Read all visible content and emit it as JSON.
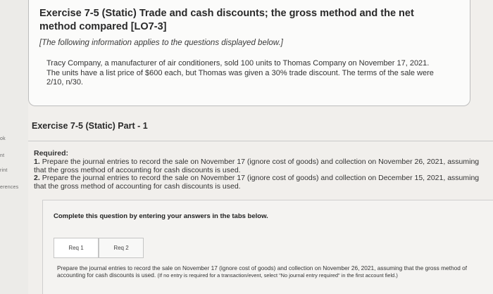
{
  "sidebar": {
    "items": [
      "ok",
      "nt",
      "rint",
      "erences"
    ]
  },
  "exercise": {
    "title": "Exercise 7-5 (Static) Trade and cash discounts; the gross method and the net method compared [LO7-3]",
    "info_note": "[The following information applies to the questions displayed below.]",
    "scenario": "Tracy Company, a manufacturer of air conditioners, sold 100 units to Thomas Company on November 17, 2021. The units have a list price of $600 each, but Thomas was given a 30% trade discount. The terms of the sale were 2/10, n/30."
  },
  "part": {
    "title": "Exercise 7-5 (Static) Part - 1"
  },
  "required": {
    "heading": "Required:",
    "item1_num": "1.",
    "item1": "Prepare the journal entries to record the sale on November 17 (ignore cost of goods) and collection on November 26, 2021, assuming that the gross method of accounting for cash discounts is used.",
    "item2_num": "2.",
    "item2": "Prepare the journal entries to record the sale on November 17 (ignore cost of goods) and collection on December 15, 2021, assuming that the gross method of accounting for cash discounts is used."
  },
  "panel": {
    "complete_note": "Complete this question by entering your answers in the tabs below.",
    "tabs": [
      {
        "label": "Req 1",
        "active": true
      },
      {
        "label": "Req 2",
        "active": false
      }
    ],
    "instruction_main": "Prepare the journal entries to record the sale on November 17 (ignore cost of goods) and collection on November 26, 2021, assuming that the gross method of accounting for cash discounts is used.",
    "instruction_small": "(If no entry is required for a transaction/event, select \"No journal entry required\" in the first account field.)"
  }
}
